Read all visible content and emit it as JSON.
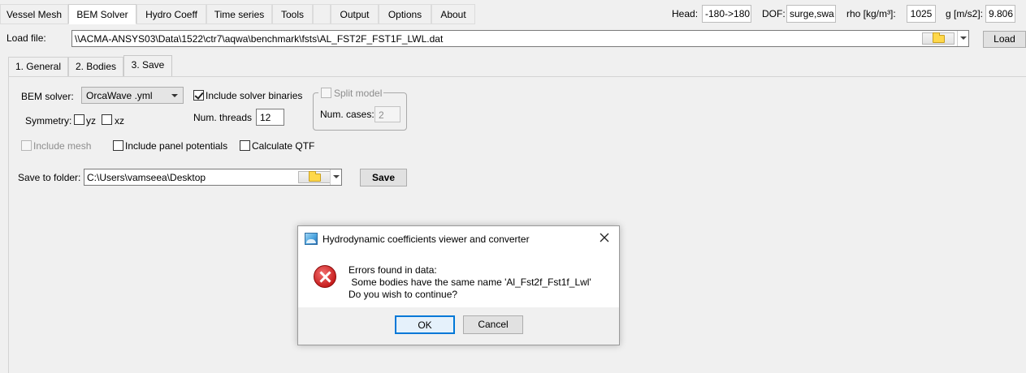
{
  "menu": {
    "tabs": [
      "Vessel Mesh",
      "BEM Solver",
      "Hydro Coeff",
      "Time series",
      "Tools",
      "Output",
      "Options",
      "About"
    ],
    "active": "BEM Solver"
  },
  "header": {
    "head_label": "Head:",
    "head_value": "-180->180",
    "dof_label": "DOF:",
    "dof_value": "surge,swa",
    "rho_label": "rho [kg/m³]:",
    "rho_value": "1025",
    "g_label": "g [m/s2]:",
    "g_value": "9.806"
  },
  "load": {
    "label": "Load file:",
    "path": "\\\\ACMA-ANSYS03\\Data\\1522\\ctr7\\aqwa\\benchmark\\fsts\\AL_FST2F_FST1F_LWL.dat",
    "button": "Load"
  },
  "subtabs": [
    "1. General",
    "2. Bodies",
    "3. Save"
  ],
  "save": {
    "bem_solver_label": "BEM solver:",
    "bem_solver_value": "OrcaWave .yml",
    "include_binaries": "Include solver binaries",
    "symmetry_label": "Symmetry:",
    "sym_yz": "yz",
    "sym_xz": "xz",
    "num_threads_label": "Num. threads",
    "num_threads": "12",
    "split_model": "Split model",
    "num_cases_label": "Num. cases:",
    "num_cases": "2",
    "include_mesh": "Include mesh",
    "include_panel": "Include panel potentials",
    "calc_qtf": "Calculate QTF",
    "save_folder_label": "Save to folder:",
    "save_folder": "C:\\Users\\vamseea\\Desktop",
    "save_button": "Save"
  },
  "dialog": {
    "title": "Hydrodynamic coefficients viewer and converter",
    "line1": "Errors found in data:",
    "line2": " Some bodies have the same name 'Al_Fst2f_Fst1f_Lwl'",
    "line3": "Do you wish to continue?",
    "ok": "OK",
    "cancel": "Cancel"
  }
}
